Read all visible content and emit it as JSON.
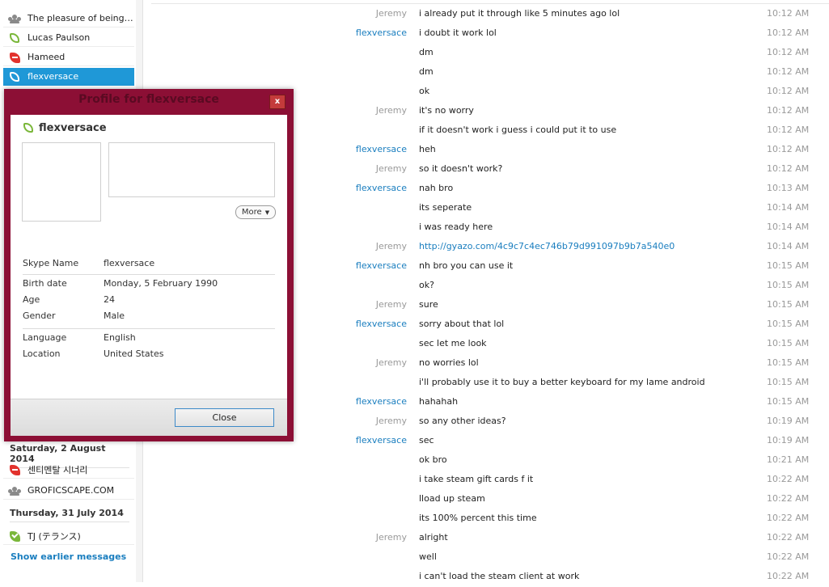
{
  "sidebar": {
    "contacts_top": [
      {
        "name": "The pleasure of being cu...",
        "status": "group"
      },
      {
        "name": "Lucas Paulson",
        "status": "online"
      },
      {
        "name": "Hameed",
        "status": "dnd"
      },
      {
        "name": "flexversace",
        "status": "online",
        "selected": true
      }
    ],
    "date_1": "Saturday, 2 August 2014",
    "contacts_d1": [
      {
        "name": "센티멘탈 시너리",
        "status": "dnd"
      },
      {
        "name": "GROFICSCAPE.COM",
        "status": "group"
      }
    ],
    "date_2": "Thursday, 31 July 2014",
    "contacts_d2": [
      {
        "name": "TJ (テランス)",
        "status": "available"
      }
    ],
    "show_earlier": "Show earlier messages"
  },
  "profile": {
    "title": "Profile for flexversace",
    "close_x": "x",
    "name": "flexversace",
    "more_label": "More",
    "fields": {
      "skype_name_label": "Skype Name",
      "skype_name": "flexversace",
      "birth_label": "Birth date",
      "birth": "Monday, 5 February 1990",
      "age_label": "Age",
      "age": "24",
      "gender_label": "Gender",
      "gender": "Male",
      "language_label": "Language",
      "language": "English",
      "location_label": "Location",
      "location": "United States"
    },
    "close_button": "Close"
  },
  "chat": {
    "messages": [
      {
        "sender": "Jeremy",
        "who": "me",
        "text": "i already put it through like 5 minutes ago lol",
        "time": "10:12 AM"
      },
      {
        "sender": "flexversace",
        "who": "them",
        "text": "i doubt it work lol",
        "time": "10:12 AM"
      },
      {
        "sender": "",
        "who": "them",
        "text": "dm",
        "time": "10:12 AM"
      },
      {
        "sender": "",
        "who": "them",
        "text": "dm",
        "time": "10:12 AM"
      },
      {
        "sender": "",
        "who": "them",
        "text": "ok",
        "time": "10:12 AM"
      },
      {
        "sender": "Jeremy",
        "who": "me",
        "text": "it's no worry",
        "time": "10:12 AM"
      },
      {
        "sender": "",
        "who": "me",
        "text": "if it doesn't work i guess i could put it to use",
        "time": "10:12 AM"
      },
      {
        "sender": "flexversace",
        "who": "them",
        "text": "heh",
        "time": "10:12 AM"
      },
      {
        "sender": "Jeremy",
        "who": "me",
        "text": "so it doesn't work?",
        "time": "10:12 AM"
      },
      {
        "sender": "flexversace",
        "who": "them",
        "text": "nah bro",
        "time": "10:13 AM"
      },
      {
        "sender": "",
        "who": "them",
        "text": "its seperate",
        "time": "10:14 AM"
      },
      {
        "sender": "",
        "who": "them",
        "text": "i was ready here",
        "time": "10:14 AM"
      },
      {
        "sender": "Jeremy",
        "who": "me",
        "text": "http://gyazo.com/4c9c7c4ec746b79d991097b9b7a540e0",
        "time": "10:14 AM",
        "link": true
      },
      {
        "sender": "flexversace",
        "who": "them",
        "text": "nh bro you can use it",
        "time": "10:15 AM"
      },
      {
        "sender": "",
        "who": "them",
        "text": "ok?",
        "time": "10:15 AM"
      },
      {
        "sender": "Jeremy",
        "who": "me",
        "text": "sure",
        "time": "10:15 AM"
      },
      {
        "sender": "flexversace",
        "who": "them",
        "text": "sorry about that lol",
        "time": "10:15 AM"
      },
      {
        "sender": "",
        "who": "them",
        "text": "sec let me look",
        "time": "10:15 AM"
      },
      {
        "sender": "Jeremy",
        "who": "me",
        "text": "no worries lol",
        "time": "10:15 AM"
      },
      {
        "sender": "",
        "who": "me",
        "text": "i'll probably use it to buy a better keyboard for my lame android",
        "time": "10:15 AM"
      },
      {
        "sender": "flexversace",
        "who": "them",
        "text": "hahahah",
        "time": "10:15 AM"
      },
      {
        "sender": "Jeremy",
        "who": "me",
        "text": "so any other ideas?",
        "time": "10:19 AM"
      },
      {
        "sender": "flexversace",
        "who": "them",
        "text": "sec",
        "time": "10:19 AM"
      },
      {
        "sender": "",
        "who": "them",
        "text": "ok bro",
        "time": "10:21 AM"
      },
      {
        "sender": "",
        "who": "them",
        "text": "i take steam gift cards f it",
        "time": "10:22 AM"
      },
      {
        "sender": "",
        "who": "them",
        "text": "lload up steam",
        "time": "10:22 AM"
      },
      {
        "sender": "",
        "who": "them",
        "text": "its 100% percent this time",
        "time": "10:22 AM"
      },
      {
        "sender": "Jeremy",
        "who": "me",
        "text": "alright",
        "time": "10:22 AM"
      },
      {
        "sender": "",
        "who": "me",
        "text": "well",
        "time": "10:22 AM"
      },
      {
        "sender": "",
        "who": "me",
        "text": "i can't load the steam client at work",
        "time": "10:22 AM"
      }
    ]
  },
  "colors": {
    "accent_blue": "#1f98d7",
    "link_blue": "#1a7ebf",
    "dialog_frame": "#8c0f35",
    "online_green": "#7ab73a",
    "dnd_red": "#e2322d"
  }
}
